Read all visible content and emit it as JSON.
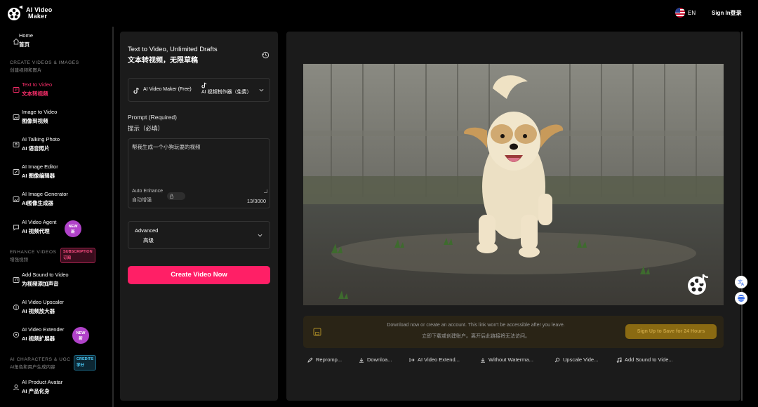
{
  "header": {
    "logo_line1": "AI Video",
    "logo_line2": "Maker",
    "language": "EN",
    "sign_in": "Sign In登录"
  },
  "sidebar": {
    "home": {
      "en": "Home",
      "zh": "首页"
    },
    "section_create": {
      "en": "CREATE VIDEOS & IMAGES",
      "zh": "创建视频和图片"
    },
    "items_create": [
      {
        "en": "Text to Video",
        "zh": "文本转视频",
        "icon": "text-video-icon",
        "active": true
      },
      {
        "en": "Image to Video",
        "zh": "图像到视频",
        "icon": "image-video-icon"
      },
      {
        "en": "AI Talking Photo",
        "zh": "AI 语音照片",
        "icon": "talking-photo-icon"
      },
      {
        "en": "AI Image Editor",
        "zh": "AI 图像编辑器",
        "icon": "image-editor-icon"
      },
      {
        "en": "AI Image Generator",
        "zh": "AI图像生成器",
        "icon": "image-generator-icon"
      },
      {
        "en": "AI Video Agent",
        "zh": "AI 视频代理",
        "icon": "video-agent-icon",
        "badge": {
          "en": "NEW",
          "zh": "新"
        }
      }
    ],
    "section_enhance": {
      "en": "ENHANCE VIDEOS",
      "zh": "增强视频",
      "badge": {
        "en": "SUBSCRIPTION",
        "zh": "订阅"
      }
    },
    "items_enhance": [
      {
        "en": "Add Sound to Video",
        "zh": "为视频添加声音",
        "icon": "add-sound-icon"
      },
      {
        "en": "AI Video Upscaler",
        "zh": "AI 视频放大器",
        "icon": "upscaler-icon"
      },
      {
        "en": "AI Video Extender",
        "zh": "AI 视频扩展器",
        "icon": "extender-icon",
        "badge": {
          "en": "NEW",
          "zh": "新"
        }
      }
    ],
    "section_characters": {
      "en": "AI CHARACTERS & UGC",
      "zh": "AI角色和用户生成内容",
      "badge": {
        "en": "CREDITS",
        "zh": "学分"
      }
    },
    "items_characters": [
      {
        "en": "AI Product Avatar",
        "zh": "AI 产品化身",
        "icon": "product-avatar-icon"
      }
    ]
  },
  "form": {
    "title_en": "Text to Video, Unlimited Drafts",
    "title_zh": "文本转视频，无限草稿",
    "model_en": "AI Video Maker (Free)",
    "model_zh": "AI 视频制作器（免费）",
    "prompt_label_en": "Prompt (Required)",
    "prompt_label_zh": "提示（必填）",
    "prompt_value": "帮我生成一个小狗玩耍的视频",
    "auto_enhance_en": "Auto Enhance",
    "auto_enhance_zh": "自动增强",
    "counter": "13/3000",
    "advanced_en": "Advanced",
    "advanced_zh": "高级",
    "create_button": "Create Video Now"
  },
  "preview": {
    "notice_line1": "Download now or create an account. This link won't be accessible after you leave.",
    "notice_line2": "立即下载或创建账户。离开后此链接将无法访问。",
    "signup_button": "Sign Up to Save for 24 Hours",
    "actions": [
      {
        "label": "Repromp...",
        "icon": "pencil-icon"
      },
      {
        "label": "Downloa...",
        "icon": "download-icon"
      },
      {
        "label": "AI Video Extend...",
        "icon": "extend-arrow-icon"
      },
      {
        "label": "Without Waterma...",
        "icon": "download-icon"
      },
      {
        "label": "Upscale Vide...",
        "icon": "search-icon"
      },
      {
        "label": "Add Sound to Vide...",
        "icon": "music-note-icon"
      }
    ]
  },
  "colors": {
    "accent": "#ff1f66",
    "active_nav": "#ff2f6d",
    "new_badge": "#b042c9",
    "signup_button": "#8a6a12"
  }
}
